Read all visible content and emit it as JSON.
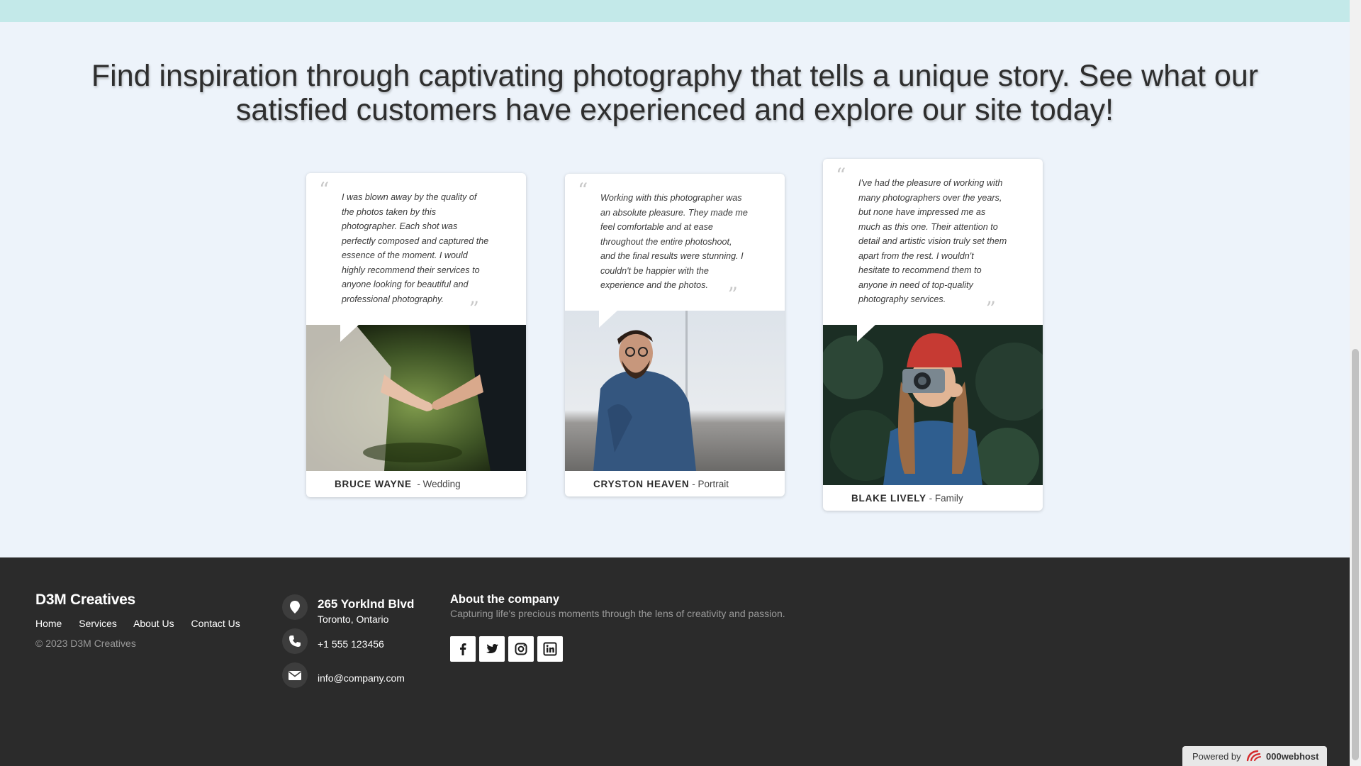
{
  "headline": "Find inspiration through captivating photography that tells a unique story. See what our satisfied customers have experienced and explore our site today!",
  "testimonials": [
    {
      "quote": "I was blown away by the quality of the photos taken by this photographer. Each shot was perfectly composed and captured the essence of the moment. I would highly recommend their services to anyone looking for beautiful and professional photography.",
      "name": "BRUCE WAYNE",
      "category": "- Wedding",
      "photo": "wedding-hands-photo"
    },
    {
      "quote": "Working with this photographer was an absolute pleasure. They made me feel comfortable and at ease throughout the entire photoshoot, and the final results were stunning. I couldn't be happier with the experience and the photos.",
      "name": "CRYSTON HEAVEN",
      "category": "- Portrait",
      "photo": "portrait-man-photo"
    },
    {
      "quote": "I've had the pleasure of working with many photographers over the years, but none have impressed me as much as this one. Their attention to detail and artistic vision truly set them apart from the rest. I wouldn't hesitate to recommend them to anyone in need of top-quality photography services.",
      "name": "BLAKE LIVELY",
      "category": "- Family",
      "photo": "woman-camera-photo"
    }
  ],
  "footer": {
    "brand": "D3M Creatives",
    "nav": [
      "Home",
      "Services",
      "About Us",
      "Contact Us"
    ],
    "copyright": "© 2023 D3M Creatives",
    "address_street": "265 Yorklnd Blvd",
    "address_city": "Toronto, Ontario",
    "phone": "+1 555 123456",
    "email": "info@company.com",
    "about_title": "About the company",
    "about_text": "Capturing life's precious moments through the lens of creativity and passion.",
    "social": [
      "facebook-icon",
      "twitter-icon",
      "instagram-icon",
      "linkedin-icon"
    ]
  },
  "powered_by": {
    "label": "Powered by",
    "brand": "000webhost"
  },
  "colors": {
    "background": "#edf3fa",
    "topbar": "#c3e9e9",
    "footer": "#2b2b2b"
  }
}
